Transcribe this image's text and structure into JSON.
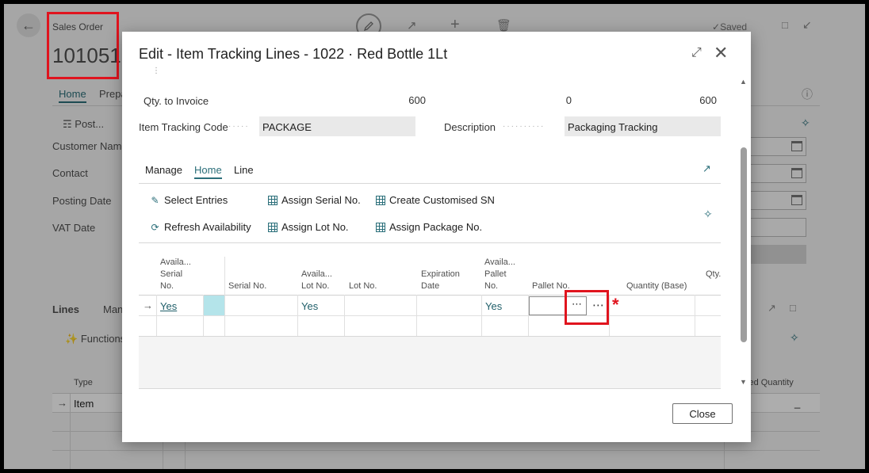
{
  "background": {
    "doc_type": "Sales Order",
    "doc_number": "101051",
    "saved": "Saved",
    "tabs": [
      "Home",
      "Prepa"
    ],
    "post_label": "Post...",
    "fields": [
      "Customer Name",
      "Contact",
      "Posting Date",
      "VAT Date"
    ],
    "lines_tab": "Lines",
    "lines_tab2": "Man",
    "functions_label": "Functions",
    "col_type": "Type",
    "col_reserved": "ved Quantity",
    "row_type": "Item",
    "row_reserved": "_"
  },
  "dialog": {
    "title": "Edit - Item Tracking Lines - 1022 · Red Bottle 1Lt",
    "qty_to_invoice": {
      "label": "Qty. to Invoice",
      "v1": "600",
      "v2": "0",
      "v3": "600"
    },
    "item_tracking_code": {
      "label": "Item Tracking Code",
      "value": "PACKAGE"
    },
    "description": {
      "label": "Description",
      "value": "Packaging Tracking"
    },
    "menu_tabs": [
      "Manage",
      "Home",
      "Line"
    ],
    "actions": {
      "select_entries": "Select Entries",
      "assign_serial": "Assign Serial No.",
      "create_custom_sn": "Create Customised SN",
      "refresh": "Refresh Availability",
      "assign_lot": "Assign Lot No.",
      "assign_package": "Assign Package No."
    },
    "columns": {
      "avail_serial": [
        "Availa...",
        "Serial",
        "No."
      ],
      "serial_no": "Serial No.",
      "avail_lot": [
        "Availa...",
        "Lot No."
      ],
      "lot_no": "Lot No.",
      "expiration": [
        "Expiration",
        "Date"
      ],
      "avail_pallet": [
        "Availa...",
        "Pallet",
        "No."
      ],
      "pallet_no": "Pallet No.",
      "qty_base": "Quantity (Base)",
      "qty": "Qty."
    },
    "row": {
      "avail_serial": "Yes",
      "avail_lot": "Yes",
      "avail_pallet": "Yes",
      "lookup": "⋯",
      "more": "⋯",
      "required": "*"
    },
    "close_label": "Close"
  },
  "colors": {
    "accent": "#2b6f7a",
    "highlight": "#e0141e",
    "selected_cell": "#b4e4ea"
  }
}
